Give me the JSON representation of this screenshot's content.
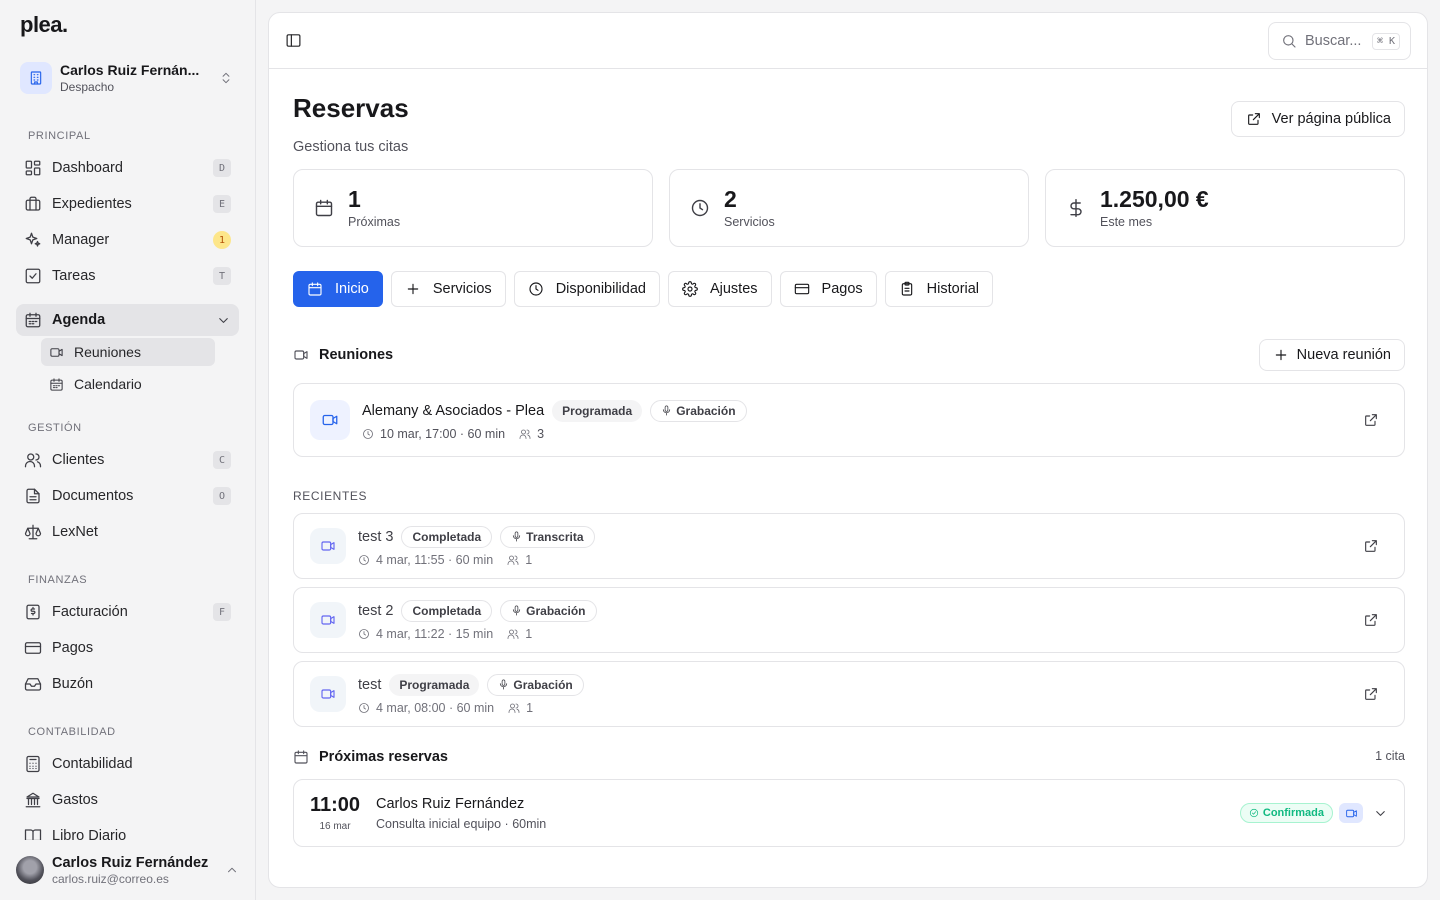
{
  "app": {
    "logo": "plea."
  },
  "org": {
    "name": "Carlos Ruiz Fernán...",
    "type": "Despacho"
  },
  "sidebar": {
    "sections": {
      "principal": "PRINCIPAL",
      "gestion": "GESTIÓN",
      "finanzas": "FINANZAS",
      "contabilidad": "CONTABILIDAD"
    },
    "items": {
      "dashboard": {
        "label": "Dashboard",
        "shortcut": "D"
      },
      "expedientes": {
        "label": "Expedientes",
        "shortcut": "E"
      },
      "manager": {
        "label": "Manager",
        "badge": "1"
      },
      "tareas": {
        "label": "Tareas",
        "shortcut": "T"
      },
      "agenda": {
        "label": "Agenda"
      },
      "reuniones": {
        "label": "Reuniones"
      },
      "calendario": {
        "label": "Calendario"
      },
      "clientes": {
        "label": "Clientes",
        "shortcut": "C"
      },
      "documentos": {
        "label": "Documentos",
        "shortcut": "O"
      },
      "lexnet": {
        "label": "LexNet"
      },
      "facturacion": {
        "label": "Facturación",
        "shortcut": "F"
      },
      "pagos": {
        "label": "Pagos"
      },
      "buzon": {
        "label": "Buzón"
      },
      "contabilidad": {
        "label": "Contabilidad"
      },
      "gastos": {
        "label": "Gastos"
      },
      "libro": {
        "label": "Libro Diario"
      }
    }
  },
  "user": {
    "name": "Carlos Ruiz Fernández",
    "email": "carlos.ruiz@correo.es"
  },
  "search": {
    "placeholder": "Buscar...",
    "shortcut": "⌘ K"
  },
  "page": {
    "title": "Reservas",
    "subtitle": "Gestiona tus citas",
    "public_button": "Ver página pública"
  },
  "stats": [
    {
      "value": "1",
      "label": "Próximas"
    },
    {
      "value": "2",
      "label": "Servicios"
    },
    {
      "value": "1.250,00 €",
      "label": "Este mes"
    }
  ],
  "tabs": [
    "Inicio",
    "Servicios",
    "Disponibilidad",
    "Ajustes",
    "Pagos",
    "Historial"
  ],
  "meetings": {
    "heading": "Reuniones",
    "new_button": "Nueva reunión",
    "upcoming": {
      "title": "Alemany & Asociados - Plea",
      "status": "Programada",
      "media": "Grabación",
      "when": "10 mar, 17:00 · 60 min",
      "attendees": "3"
    },
    "recent_label": "RECIENTES",
    "recent": [
      {
        "title": "test 3",
        "status": "Completada",
        "media": "Transcrita",
        "when": "4 mar, 11:55 · 60 min",
        "attendees": "1"
      },
      {
        "title": "test 2",
        "status": "Completada",
        "media": "Grabación",
        "when": "4 mar, 11:22 · 15 min",
        "attendees": "1"
      },
      {
        "title": "test",
        "status": "Programada",
        "media": "Grabación",
        "when": "4 mar, 08:00 · 60 min",
        "attendees": "1"
      }
    ]
  },
  "bookings": {
    "heading": "Próximas reservas",
    "count": "1 cita",
    "items": [
      {
        "time": "11:00",
        "date": "16 mar",
        "name": "Carlos Ruiz Fernández",
        "desc": "Consulta inicial equipo · 60min",
        "status": "Confirmada"
      }
    ]
  },
  "colors": {
    "accent": "#2563eb",
    "success": "#10b981",
    "warning_badge": "#fde68a"
  }
}
